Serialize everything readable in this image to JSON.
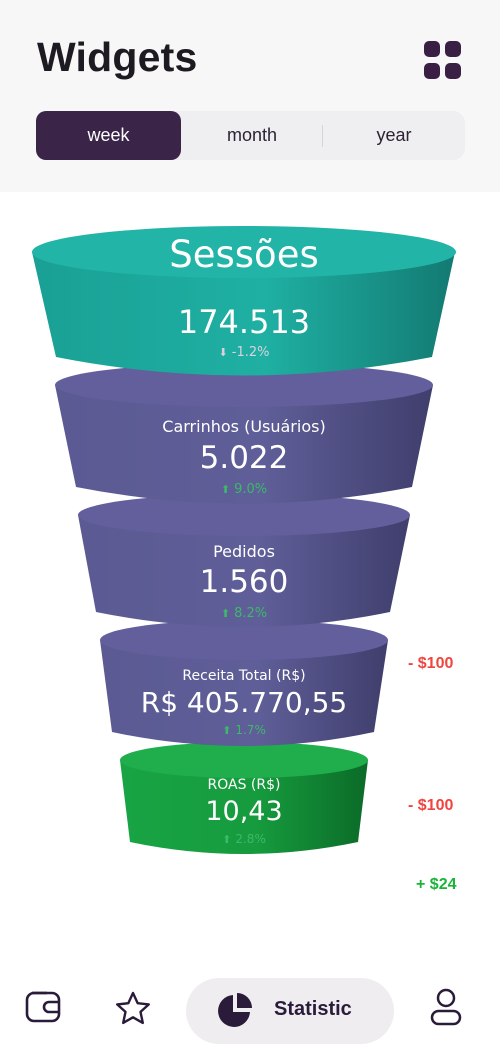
{
  "header": {
    "title": "Widgets",
    "menu_icon": "grid-icon"
  },
  "period_tabs": [
    {
      "label": "week",
      "selected": true
    },
    {
      "label": "month",
      "selected": false
    },
    {
      "label": "year",
      "selected": false
    }
  ],
  "funnel": [
    {
      "label": "Sessões",
      "value": "174.513",
      "change": "-1.2%",
      "direction": "down",
      "color": "#1fa59a"
    },
    {
      "label": "Carrinhos (Usuários)",
      "value": "5.022",
      "change": "9.0%",
      "direction": "up",
      "color": "#5c5a92"
    },
    {
      "label": "Pedidos",
      "value": "1.560",
      "change": "8.2%",
      "direction": "up",
      "color": "#5c5a92"
    },
    {
      "label": "Receita Total (R$)",
      "value": "R$ 405.770,55",
      "change": "1.7%",
      "direction": "up",
      "color": "#5c5a92"
    },
    {
      "label": "ROAS (R$)",
      "value": "10,43",
      "change": "2.8%",
      "direction": "up",
      "color": "#17913c"
    }
  ],
  "side_deltas": [
    {
      "text": "- $100",
      "color": "#f0443f"
    },
    {
      "text": "- $100",
      "color": "#f0443f"
    },
    {
      "text": "+ $24",
      "color": "#18b33a"
    }
  ],
  "bottom_nav": {
    "items": [
      {
        "icon": "wallet-icon"
      },
      {
        "icon": "star-icon"
      },
      {
        "icon": "pie-chart-icon",
        "label": "Statistic",
        "active": true
      },
      {
        "icon": "user-icon"
      }
    ]
  },
  "colors": {
    "accent": "#3a2448",
    "change_up": "#3cb96a",
    "change_down": "#d9d2dc"
  }
}
